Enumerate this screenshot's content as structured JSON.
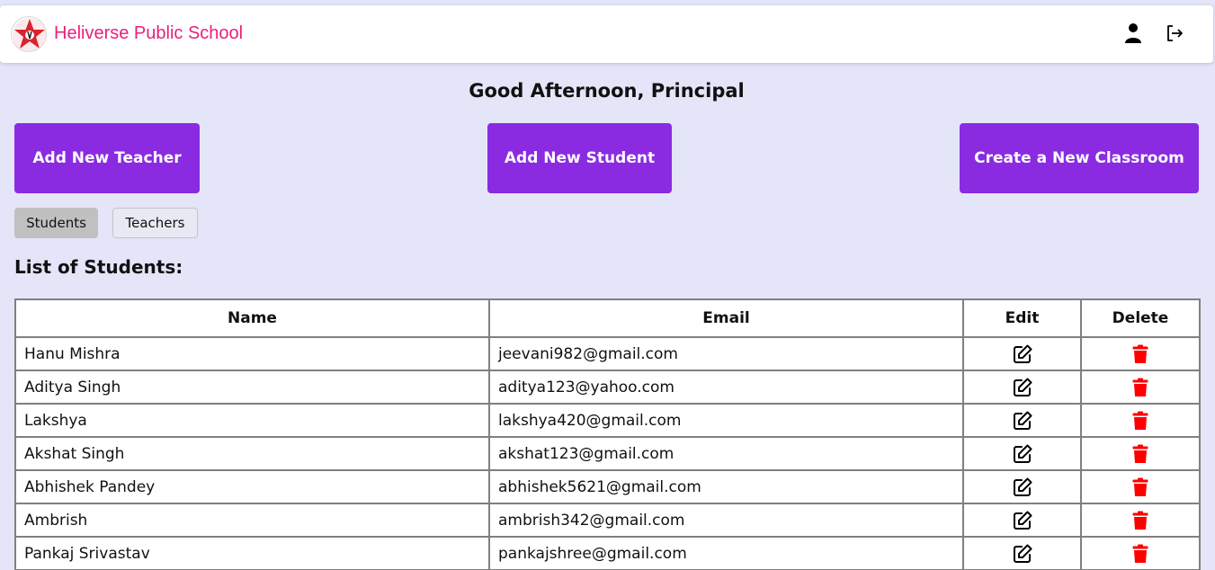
{
  "header": {
    "brand": "Heliverse Public School",
    "icons": [
      "user-icon",
      "logout-icon"
    ]
  },
  "greeting": "Good Afternoon, Principal",
  "actions": {
    "add_teacher": "Add New Teacher",
    "add_student": "Add New Student",
    "create_classroom": "Create a New Classroom"
  },
  "tabs": [
    {
      "label": "Students",
      "active": true
    },
    {
      "label": "Teachers",
      "active": false
    }
  ],
  "list_title": "List of Students:",
  "table": {
    "columns": [
      "Name",
      "Email",
      "Edit",
      "Delete"
    ],
    "rows": [
      {
        "name": "Hanu Mishra",
        "email": "jeevani982@gmail.com"
      },
      {
        "name": "Aditya Singh",
        "email": "aditya123@yahoo.com"
      },
      {
        "name": "Lakshya",
        "email": "lakshya420@gmail.com"
      },
      {
        "name": "Akshat Singh",
        "email": "akshat123@gmail.com"
      },
      {
        "name": "Abhishek Pandey",
        "email": "abhishek5621@gmail.com"
      },
      {
        "name": "Ambrish",
        "email": "ambrish342@gmail.com"
      },
      {
        "name": "Pankaj Srivastav",
        "email": "pankajshree@gmail.com"
      }
    ]
  },
  "colors": {
    "brand": "#e8207d",
    "accent": "#8a2be2",
    "background": "#e4e5f8",
    "delete": "#ff0000"
  }
}
